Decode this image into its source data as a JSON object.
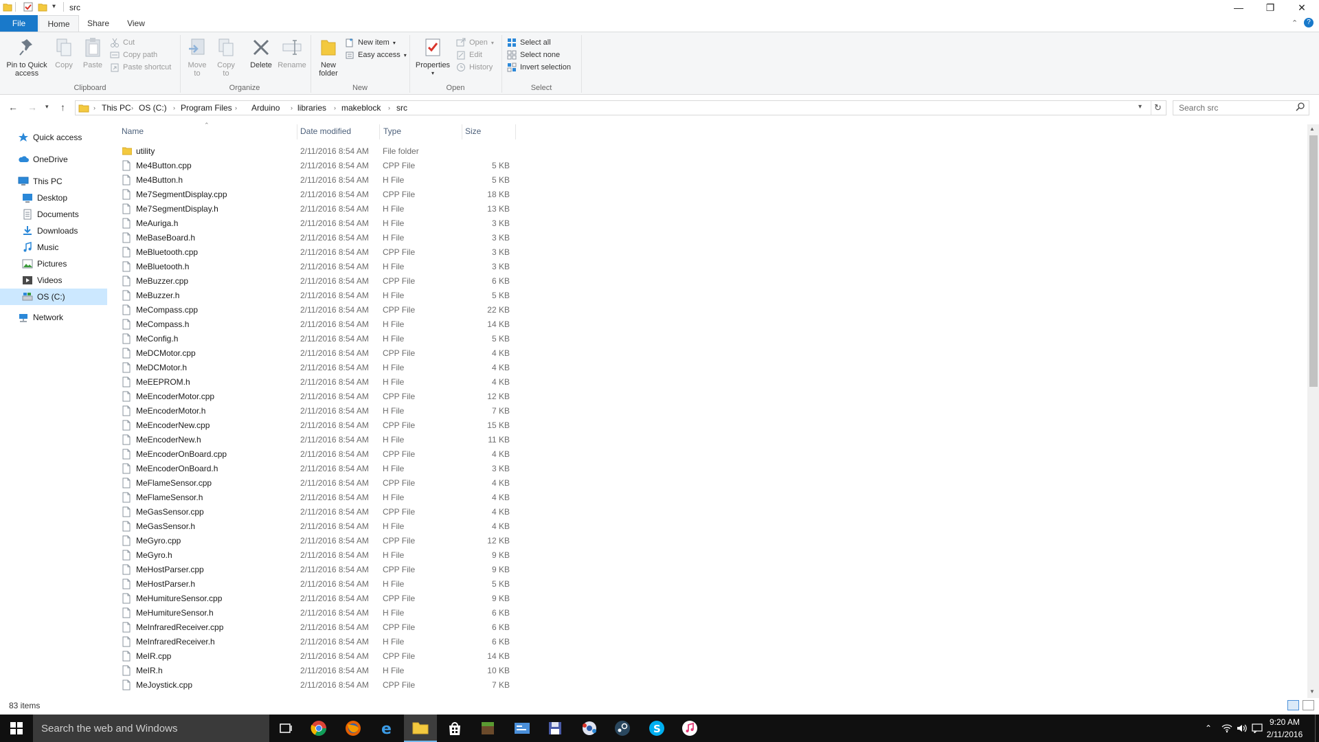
{
  "window": {
    "title": "src",
    "minimize": "—",
    "maximize": "❐",
    "close": "✕"
  },
  "ribbon_tabs": [
    {
      "label": "File"
    },
    {
      "label": "Home"
    },
    {
      "label": "Share"
    },
    {
      "label": "View"
    }
  ],
  "ribbon": {
    "clipboard": {
      "label": "Clipboard",
      "pin": "Pin to Quick\naccess",
      "copy": "Copy",
      "paste": "Paste",
      "cut": "Cut",
      "copy_path": "Copy path",
      "paste_shortcut": "Paste shortcut"
    },
    "organize": {
      "label": "Organize",
      "move_to": "Move\nto",
      "copy_to": "Copy\nto",
      "delete": "Delete",
      "rename": "Rename"
    },
    "new": {
      "label": "New",
      "new_folder": "New\nfolder",
      "new_item": "New item",
      "easy_access": "Easy access"
    },
    "open": {
      "label": "Open",
      "properties": "Properties",
      "open": "Open",
      "edit": "Edit",
      "history": "History"
    },
    "select": {
      "label": "Select",
      "select_all": "Select all",
      "select_none": "Select none",
      "invert": "Invert selection"
    }
  },
  "address": {
    "crumbs": [
      "This PC",
      "OS (C:)",
      "Program Files",
      "Arduino",
      "libraries",
      "makeblock",
      "src"
    ],
    "search_placeholder": "Search src"
  },
  "nav": {
    "quick_access": "Quick access",
    "onedrive": "OneDrive",
    "this_pc": "This PC",
    "desktop": "Desktop",
    "documents": "Documents",
    "downloads": "Downloads",
    "music": "Music",
    "pictures": "Pictures",
    "videos": "Videos",
    "os_c": "OS (C:)",
    "network": "Network"
  },
  "columns": {
    "name": "Name",
    "date": "Date modified",
    "type": "Type",
    "size": "Size"
  },
  "files": [
    {
      "name": "utility",
      "date": "2/11/2016 8:54 AM",
      "type": "File folder",
      "size": "",
      "folder": true
    },
    {
      "name": "Me4Button.cpp",
      "date": "2/11/2016 8:54 AM",
      "type": "CPP File",
      "size": "5 KB"
    },
    {
      "name": "Me4Button.h",
      "date": "2/11/2016 8:54 AM",
      "type": "H File",
      "size": "5 KB"
    },
    {
      "name": "Me7SegmentDisplay.cpp",
      "date": "2/11/2016 8:54 AM",
      "type": "CPP File",
      "size": "18 KB"
    },
    {
      "name": "Me7SegmentDisplay.h",
      "date": "2/11/2016 8:54 AM",
      "type": "H File",
      "size": "13 KB"
    },
    {
      "name": "MeAuriga.h",
      "date": "2/11/2016 8:54 AM",
      "type": "H File",
      "size": "3 KB"
    },
    {
      "name": "MeBaseBoard.h",
      "date": "2/11/2016 8:54 AM",
      "type": "H File",
      "size": "3 KB"
    },
    {
      "name": "MeBluetooth.cpp",
      "date": "2/11/2016 8:54 AM",
      "type": "CPP File",
      "size": "3 KB"
    },
    {
      "name": "MeBluetooth.h",
      "date": "2/11/2016 8:54 AM",
      "type": "H File",
      "size": "3 KB"
    },
    {
      "name": "MeBuzzer.cpp",
      "date": "2/11/2016 8:54 AM",
      "type": "CPP File",
      "size": "6 KB"
    },
    {
      "name": "MeBuzzer.h",
      "date": "2/11/2016 8:54 AM",
      "type": "H File",
      "size": "5 KB"
    },
    {
      "name": "MeCompass.cpp",
      "date": "2/11/2016 8:54 AM",
      "type": "CPP File",
      "size": "22 KB"
    },
    {
      "name": "MeCompass.h",
      "date": "2/11/2016 8:54 AM",
      "type": "H File",
      "size": "14 KB"
    },
    {
      "name": "MeConfig.h",
      "date": "2/11/2016 8:54 AM",
      "type": "H File",
      "size": "5 KB"
    },
    {
      "name": "MeDCMotor.cpp",
      "date": "2/11/2016 8:54 AM",
      "type": "CPP File",
      "size": "4 KB"
    },
    {
      "name": "MeDCMotor.h",
      "date": "2/11/2016 8:54 AM",
      "type": "H File",
      "size": "4 KB"
    },
    {
      "name": "MeEEPROM.h",
      "date": "2/11/2016 8:54 AM",
      "type": "H File",
      "size": "4 KB"
    },
    {
      "name": "MeEncoderMotor.cpp",
      "date": "2/11/2016 8:54 AM",
      "type": "CPP File",
      "size": "12 KB"
    },
    {
      "name": "MeEncoderMotor.h",
      "date": "2/11/2016 8:54 AM",
      "type": "H File",
      "size": "7 KB"
    },
    {
      "name": "MeEncoderNew.cpp",
      "date": "2/11/2016 8:54 AM",
      "type": "CPP File",
      "size": "15 KB"
    },
    {
      "name": "MeEncoderNew.h",
      "date": "2/11/2016 8:54 AM",
      "type": "H File",
      "size": "11 KB"
    },
    {
      "name": "MeEncoderOnBoard.cpp",
      "date": "2/11/2016 8:54 AM",
      "type": "CPP File",
      "size": "4 KB"
    },
    {
      "name": "MeEncoderOnBoard.h",
      "date": "2/11/2016 8:54 AM",
      "type": "H File",
      "size": "3 KB"
    },
    {
      "name": "MeFlameSensor.cpp",
      "date": "2/11/2016 8:54 AM",
      "type": "CPP File",
      "size": "4 KB"
    },
    {
      "name": "MeFlameSensor.h",
      "date": "2/11/2016 8:54 AM",
      "type": "H File",
      "size": "4 KB"
    },
    {
      "name": "MeGasSensor.cpp",
      "date": "2/11/2016 8:54 AM",
      "type": "CPP File",
      "size": "4 KB"
    },
    {
      "name": "MeGasSensor.h",
      "date": "2/11/2016 8:54 AM",
      "type": "H File",
      "size": "4 KB"
    },
    {
      "name": "MeGyro.cpp",
      "date": "2/11/2016 8:54 AM",
      "type": "CPP File",
      "size": "12 KB"
    },
    {
      "name": "MeGyro.h",
      "date": "2/11/2016 8:54 AM",
      "type": "H File",
      "size": "9 KB"
    },
    {
      "name": "MeHostParser.cpp",
      "date": "2/11/2016 8:54 AM",
      "type": "CPP File",
      "size": "9 KB"
    },
    {
      "name": "MeHostParser.h",
      "date": "2/11/2016 8:54 AM",
      "type": "H File",
      "size": "5 KB"
    },
    {
      "name": "MeHumitureSensor.cpp",
      "date": "2/11/2016 8:54 AM",
      "type": "CPP File",
      "size": "9 KB"
    },
    {
      "name": "MeHumitureSensor.h",
      "date": "2/11/2016 8:54 AM",
      "type": "H File",
      "size": "6 KB"
    },
    {
      "name": "MeInfraredReceiver.cpp",
      "date": "2/11/2016 8:54 AM",
      "type": "CPP File",
      "size": "6 KB"
    },
    {
      "name": "MeInfraredReceiver.h",
      "date": "2/11/2016 8:54 AM",
      "type": "H File",
      "size": "6 KB"
    },
    {
      "name": "MeIR.cpp",
      "date": "2/11/2016 8:54 AM",
      "type": "CPP File",
      "size": "14 KB"
    },
    {
      "name": "MeIR.h",
      "date": "2/11/2016 8:54 AM",
      "type": "H File",
      "size": "10 KB"
    },
    {
      "name": "MeJoystick.cpp",
      "date": "2/11/2016 8:54 AM",
      "type": "CPP File",
      "size": "7 KB"
    }
  ],
  "status": {
    "item_count": "83 items"
  },
  "taskbar": {
    "search_placeholder": "Search the web and Windows",
    "time": "9:20 AM",
    "date": "2/11/2016"
  },
  "colors": {
    "accent": "#1979ca",
    "selection": "#cce8ff",
    "folder": "#f3c93f",
    "taskbar": "#101010"
  }
}
